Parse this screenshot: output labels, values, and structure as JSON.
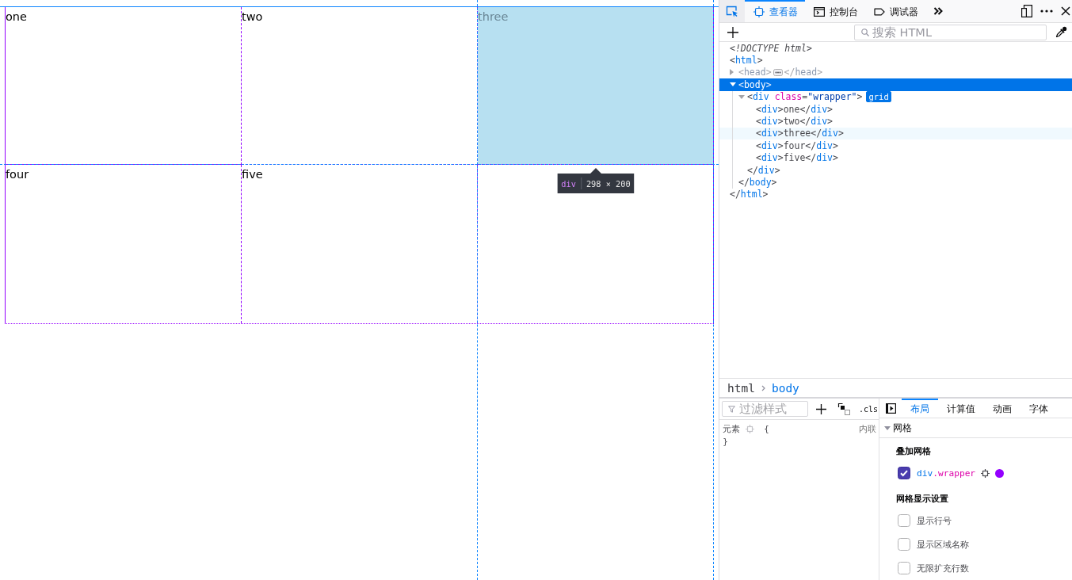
{
  "page": {
    "grid": {
      "cells": [
        {
          "text": "one",
          "highlighted": false
        },
        {
          "text": "two",
          "highlighted": false
        },
        {
          "text": "three",
          "highlighted": true
        },
        {
          "text": "four",
          "highlighted": false
        },
        {
          "text": "five",
          "highlighted": false
        }
      ]
    },
    "tooltip": {
      "tag": "div",
      "size": "298 × 200"
    }
  },
  "devtools": {
    "tabs": [
      {
        "kind": "inspector",
        "label": "查看器",
        "selected": true
      },
      {
        "kind": "console",
        "label": "控制台",
        "selected": false
      },
      {
        "kind": "debugger",
        "label": "调试器",
        "selected": false
      }
    ],
    "search": {
      "placeholder": "搜索 HTML"
    },
    "markup": {
      "doctype": "<!DOCTYPE html>",
      "nodes": [
        {
          "open": [
            {
              "kind": "punct",
              "text": "<"
            },
            {
              "kind": "tag",
              "text": "html"
            },
            {
              "kind": "punct",
              "text": ">"
            }
          ],
          "close": [
            {
              "kind": "punct",
              "text": "</"
            },
            {
              "kind": "tag",
              "text": "html"
            },
            {
              "kind": "punct",
              "text": ">"
            }
          ],
          "selected": false,
          "highlighted": false,
          "dimmed": false,
          "children": [
            {
              "open": [
                {
                  "kind": "punct",
                  "text": "<"
                },
                {
                  "kind": "tag",
                  "text": "head"
                },
                {
                  "kind": "punct",
                  "text": ">"
                }
              ],
              "close": [
                {
                  "kind": "punct",
                  "text": "</"
                },
                {
                  "kind": "tag",
                  "text": "head"
                },
                {
                  "kind": "punct",
                  "text": ">"
                }
              ],
              "expanded": false,
              "selected": false,
              "highlighted": false,
              "dimmed": true
            },
            {
              "open": [
                {
                  "kind": "punct",
                  "text": "<"
                },
                {
                  "kind": "tag",
                  "text": "body"
                },
                {
                  "kind": "punct",
                  "text": ">"
                }
              ],
              "close": [
                {
                  "kind": "punct",
                  "text": "</"
                },
                {
                  "kind": "tag",
                  "text": "body"
                },
                {
                  "kind": "punct",
                  "text": ">"
                }
              ],
              "expanded": true,
              "selected": true,
              "highlighted": false,
              "dimmed": false,
              "children": [
                {
                  "open": [
                    {
                      "kind": "punct",
                      "text": "<"
                    },
                    {
                      "kind": "tag",
                      "text": "div"
                    },
                    {
                      "kind": "attr",
                      "text": " class"
                    },
                    {
                      "kind": "punct",
                      "text": "="
                    },
                    {
                      "kind": "value",
                      "text": "\"wrapper\""
                    },
                    {
                      "kind": "punct",
                      "text": ">"
                    }
                  ],
                  "close": [
                    {
                      "kind": "punct",
                      "text": "</"
                    },
                    {
                      "kind": "tag",
                      "text": "div"
                    },
                    {
                      "kind": "punct",
                      "text": ">"
                    }
                  ],
                  "badge": {
                    "text": "grid",
                    "active": true
                  },
                  "expanded": true,
                  "selected": false,
                  "highlighted": false,
                  "dimmed": false,
                  "children": [
                    {
                      "open": [
                        {
                          "kind": "punct",
                          "text": "<"
                        },
                        {
                          "kind": "tag",
                          "text": "div"
                        },
                        {
                          "kind": "punct",
                          "text": ">"
                        }
                      ],
                      "text": "one",
                      "close": [
                        {
                          "kind": "punct",
                          "text": "</"
                        },
                        {
                          "kind": "tag",
                          "text": "div"
                        },
                        {
                          "kind": "punct",
                          "text": ">"
                        }
                      ],
                      "selected": false,
                      "highlighted": false,
                      "dimmed": false
                    },
                    {
                      "open": [
                        {
                          "kind": "punct",
                          "text": "<"
                        },
                        {
                          "kind": "tag",
                          "text": "div"
                        },
                        {
                          "kind": "punct",
                          "text": ">"
                        }
                      ],
                      "text": "two",
                      "close": [
                        {
                          "kind": "punct",
                          "text": "</"
                        },
                        {
                          "kind": "tag",
                          "text": "div"
                        },
                        {
                          "kind": "punct",
                          "text": ">"
                        }
                      ],
                      "selected": false,
                      "highlighted": false,
                      "dimmed": false
                    },
                    {
                      "open": [
                        {
                          "kind": "punct",
                          "text": "<"
                        },
                        {
                          "kind": "tag",
                          "text": "div"
                        },
                        {
                          "kind": "punct",
                          "text": ">"
                        }
                      ],
                      "text": "three",
                      "close": [
                        {
                          "kind": "punct",
                          "text": "</"
                        },
                        {
                          "kind": "tag",
                          "text": "div"
                        },
                        {
                          "kind": "punct",
                          "text": ">"
                        }
                      ],
                      "selected": false,
                      "highlighted": true,
                      "dimmed": false
                    },
                    {
                      "open": [
                        {
                          "kind": "punct",
                          "text": "<"
                        },
                        {
                          "kind": "tag",
                          "text": "div"
                        },
                        {
                          "kind": "punct",
                          "text": ">"
                        }
                      ],
                      "text": "four",
                      "close": [
                        {
                          "kind": "punct",
                          "text": "</"
                        },
                        {
                          "kind": "tag",
                          "text": "div"
                        },
                        {
                          "kind": "punct",
                          "text": ">"
                        }
                      ],
                      "selected": false,
                      "highlighted": false,
                      "dimmed": false
                    },
                    {
                      "open": [
                        {
                          "kind": "punct",
                          "text": "<"
                        },
                        {
                          "kind": "tag",
                          "text": "div"
                        },
                        {
                          "kind": "punct",
                          "text": ">"
                        }
                      ],
                      "text": "five",
                      "close": [
                        {
                          "kind": "punct",
                          "text": "</"
                        },
                        {
                          "kind": "tag",
                          "text": "div"
                        },
                        {
                          "kind": "punct",
                          "text": ">"
                        }
                      ],
                      "selected": false,
                      "highlighted": false,
                      "dimmed": false
                    }
                  ]
                }
              ]
            }
          ]
        }
      ]
    },
    "breadcrumbs": [
      {
        "label": "html",
        "selected": false
      },
      {
        "label": "body",
        "selected": true
      }
    ],
    "rules": {
      "filter": {
        "placeholder": "过滤样式"
      },
      "class_toggle": ".cls",
      "rule": {
        "selector": "元素",
        "open_brace": "{",
        "close_brace": "}",
        "source": "内联"
      }
    },
    "layout": {
      "tabs": [
        {
          "label": "布局",
          "selected": true
        },
        {
          "label": "计算值",
          "selected": false
        },
        {
          "label": "动画",
          "selected": false
        },
        {
          "label": "字体",
          "selected": false
        }
      ],
      "section": {
        "title": "网格",
        "expanded": true
      },
      "overlay_heading": "叠加网格",
      "overlays": [
        {
          "element": "div",
          "class": ".wrapper",
          "checked": true,
          "color": "#9400ff"
        }
      ],
      "settings_heading": "网格显示设置",
      "settings": [
        {
          "label": "显示行号",
          "checked": false
        },
        {
          "label": "显示区域名称",
          "checked": false
        },
        {
          "label": "无限扩充行数",
          "checked": false
        }
      ]
    }
  }
}
